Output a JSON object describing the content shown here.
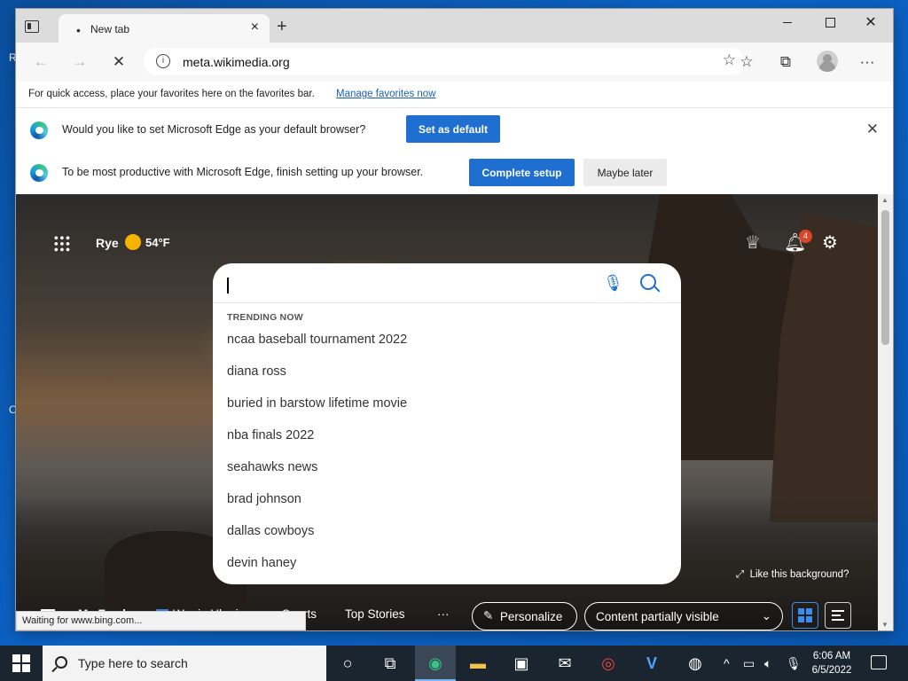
{
  "tab": {
    "title": "New tab"
  },
  "address": {
    "url": "meta.wikimedia.org"
  },
  "favorites_bar": {
    "message": "For quick access, place your favorites here on the favorites bar.",
    "link": "Manage favorites now"
  },
  "infobar_default": {
    "message": "Would you like to set Microsoft Edge as your default browser?",
    "button": "Set as default"
  },
  "infobar_setup": {
    "message": "To be most productive with Microsoft Edge, finish setting up your browser.",
    "primary_button": "Complete setup",
    "secondary_button": "Maybe later"
  },
  "ntp": {
    "location": "Rye",
    "temperature": "54°F",
    "notification_count": "4",
    "trending_header": "TRENDING NOW",
    "trending": [
      "ncaa baseball tournament 2022",
      "diana ross",
      "buried in barstow lifetime movie",
      "nba finals 2022",
      "seahawks news",
      "brad johnson",
      "dallas cowboys",
      "devin haney"
    ],
    "like_background": "Like this background?",
    "feed": {
      "my_feed": "My Feed",
      "war": "War in Ukraine",
      "sports": "Sports",
      "top_stories": "Top Stories",
      "more": "···",
      "personalize": "Personalize",
      "content": "Content partially visible"
    }
  },
  "status_text": "Waiting for www.bing.com...",
  "taskbar": {
    "search_placeholder": "Type here to search",
    "time": "6:06 AM",
    "date": "6/5/2022"
  },
  "colors": {
    "accent": "#1f6fd1",
    "badge": "#d9472b",
    "taskbar": "#1b2530"
  },
  "icons": [
    "tab-actions-icon",
    "close-icon",
    "plus-icon",
    "minimize-icon",
    "maximize-icon",
    "back-icon",
    "forward-icon",
    "stop-icon",
    "info-icon",
    "add-favorite-icon",
    "favorites-icon",
    "collections-icon",
    "profile-icon",
    "more-icon",
    "edge-logo-icon",
    "apps-icon",
    "sun-icon",
    "rewards-icon",
    "bell-icon",
    "settings-icon",
    "mic-icon",
    "search-icon",
    "expand-icon",
    "pencil-icon",
    "chevron-down-icon",
    "grid-icon",
    "list-icon",
    "windows-start-icon",
    "task-view-icon",
    "cortana-icon",
    "edge-icon",
    "file-explorer-icon",
    "store-icon",
    "mail-icon",
    "chrome-icon",
    "network-icon",
    "volume-icon",
    "microphone-icon",
    "notifications-icon"
  ]
}
